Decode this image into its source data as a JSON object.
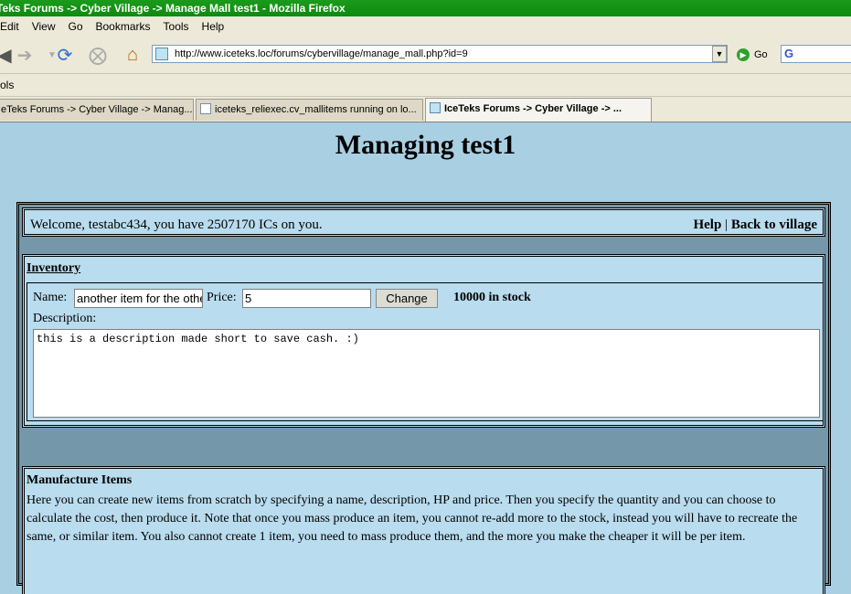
{
  "window": {
    "title": "Teks Forums -> Cyber Village -> Manage Mall test1 - Mozilla Firefox"
  },
  "menu": {
    "items": [
      "Edit",
      "View",
      "Go",
      "Bookmarks",
      "Tools",
      "Help"
    ]
  },
  "navbar": {
    "url": "http://www.iceteks.loc/forums/cybervillage/manage_mall.php?id=9",
    "go_label": "Go",
    "search_logo": "G"
  },
  "bookmarks": {
    "label": "ols"
  },
  "tabs": [
    {
      "label": "eTeks Forums -> Cyber Village -> Manag..."
    },
    {
      "label": "iceteks_reliexec.cv_mallitems running on lo..."
    },
    {
      "label": "IceTeks Forums -> Cyber Village -> ..."
    }
  ],
  "page": {
    "heading": "Managing test1",
    "welcome": {
      "text": "Welcome, testabc434, you have 2507170 ICs on you.",
      "help": "Help",
      "separator": "|",
      "back": "Back to village"
    },
    "inventory": {
      "title": "Inventory",
      "name_label": "Name:",
      "name_value": "another item for the othe",
      "price_label": "Price:",
      "price_value": "5",
      "change_button": "Change",
      "stock": "10000 in stock",
      "description_label": "Description:",
      "description_value": "this is a description made short to save cash. :)"
    },
    "manufacture": {
      "title": "Manufacture Items",
      "text": "Here you can create new items from scratch by specifying a name, description, HP and price. Then you specify the quantity and you can choose to calculate the cost, then produce it. Note that once you mass produce an item, you cannot re-add more to the stock, instead you will have to recreate the same, or similar item. You also cannot create 1 item, you need to mass produce them, and the more you make the cheaper it will be per item."
    }
  }
}
